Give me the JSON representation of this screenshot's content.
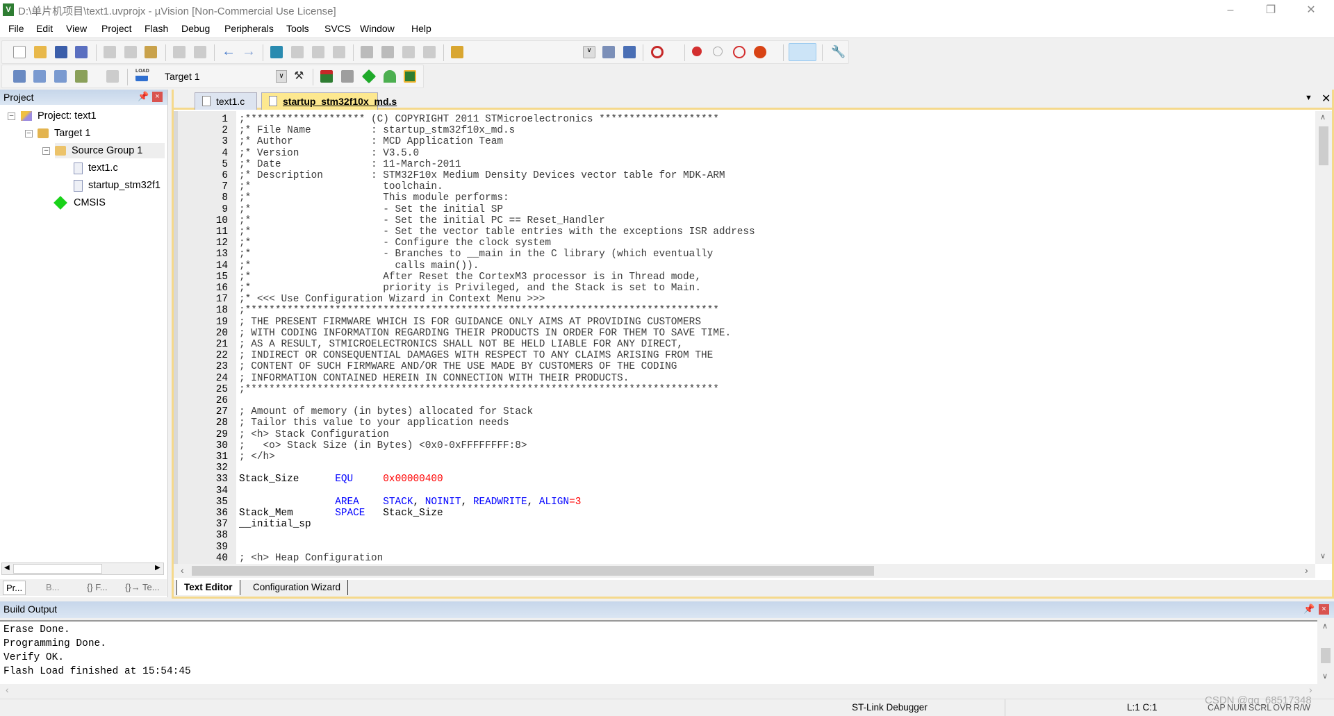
{
  "window": {
    "title": "D:\\单片机项目\\text1.uvprojx - µVision  [Non-Commercial Use License]",
    "app_icon": "V",
    "controls": [
      "minimize-icon",
      "restore-icon",
      "close-icon"
    ]
  },
  "menu": [
    "File",
    "Edit",
    "View",
    "Project",
    "Flash",
    "Debug",
    "Peripherals",
    "Tools",
    "SVCS",
    "Window",
    "Help"
  ],
  "toolbar": {
    "target": "Target 1",
    "icons1": [
      "new-file-icon",
      "open-icon",
      "save-icon",
      "save-all-icon",
      "cut-icon",
      "copy-icon",
      "paste-icon",
      "undo-icon",
      "redo-icon",
      "nav-back-icon",
      "nav-forward-icon",
      "bookmark-icon",
      "prev-bookmark-icon",
      "next-bookmark-icon",
      "clear-bookmarks-icon",
      "indent-icon",
      "unindent-icon",
      "comment-icon",
      "uncomment-icon",
      "find-in-files-icon",
      "dropdown-icon",
      "find-icon",
      "incremental-find-icon",
      "debug-session-icon",
      "breakpoint-icon",
      "disable-breakpoint-icon",
      "kill-breakpoints-icon",
      "debug-settings-icon",
      "window-layout-icon",
      "configure-icon"
    ],
    "icons2": [
      "translate-icon",
      "build-icon",
      "rebuild-icon",
      "batch-build-icon",
      "stop-build-icon",
      "download-icon",
      "target-options-icon",
      "file-extensions-icon",
      "manage-components-icon",
      "pack-installer-icon",
      "select-packs-icon",
      "run-env-icon"
    ],
    "load_label": "LOAD"
  },
  "project": {
    "title": "Project",
    "tree": [
      {
        "label": "Project: text1",
        "level": 0,
        "icon": "project-icon",
        "expanded": true
      },
      {
        "label": "Target 1",
        "level": 1,
        "icon": "target-folder-icon",
        "expanded": true
      },
      {
        "label": "Source Group 1",
        "level": 2,
        "icon": "folder-icon",
        "expanded": true,
        "selected": true
      },
      {
        "label": "text1.c",
        "level": 3,
        "icon": "file-icon"
      },
      {
        "label": "startup_stm32f1",
        "level": 3,
        "icon": "file-icon"
      },
      {
        "label": "CMSIS",
        "level": 2,
        "icon": "cmsis-icon"
      }
    ],
    "tabs": [
      "Pr...",
      "B...",
      "{} F...",
      "{}→ Te..."
    ]
  },
  "editor": {
    "tabs": [
      {
        "label": "text1.c",
        "active": false
      },
      {
        "label": "startup_stm32f10x_md.s",
        "active": true
      }
    ],
    "bottom_tabs": [
      "Text Editor",
      "Configuration Wizard"
    ],
    "lines": [
      [
        {
          "t": ";******************** (C) COPYRIGHT 2011 STMicroelectronics ********************",
          "c": "cm"
        }
      ],
      [
        {
          "t": ";* File Name          : startup_stm32f10x_md.s",
          "c": "cm"
        }
      ],
      [
        {
          "t": ";* Author             : MCD Application Team",
          "c": "cm"
        }
      ],
      [
        {
          "t": ";* Version            : V3.5.0",
          "c": "cm"
        }
      ],
      [
        {
          "t": ";* Date               : 11-March-2011",
          "c": "cm"
        }
      ],
      [
        {
          "t": ";* Description        : STM32F10x Medium Density Devices vector table for MDK-ARM",
          "c": "cm"
        }
      ],
      [
        {
          "t": ";*                      toolchain.",
          "c": "cm"
        }
      ],
      [
        {
          "t": ";*                      This module performs:",
          "c": "cm"
        }
      ],
      [
        {
          "t": ";*                      - Set the initial SP",
          "c": "cm"
        }
      ],
      [
        {
          "t": ";*                      - Set the initial PC == Reset_Handler",
          "c": "cm"
        }
      ],
      [
        {
          "t": ";*                      - Set the vector table entries with the exceptions ISR address",
          "c": "cm"
        }
      ],
      [
        {
          "t": ";*                      - Configure the clock system",
          "c": "cm"
        }
      ],
      [
        {
          "t": ";*                      - Branches to __main in the C library (which eventually",
          "c": "cm"
        }
      ],
      [
        {
          "t": ";*                        calls main()).",
          "c": "cm"
        }
      ],
      [
        {
          "t": ";*                      After Reset the CortexM3 processor is in Thread mode,",
          "c": "cm"
        }
      ],
      [
        {
          "t": ";*                      priority is Privileged, and the Stack is set to Main.",
          "c": "cm"
        }
      ],
      [
        {
          "t": ";* <<< Use Configuration Wizard in Context Menu >>>",
          "c": "cm"
        }
      ],
      [
        {
          "t": ";*******************************************************************************",
          "c": "cm"
        }
      ],
      [
        {
          "t": "; THE PRESENT FIRMWARE WHICH IS FOR GUIDANCE ONLY AIMS AT PROVIDING CUSTOMERS",
          "c": "cm"
        }
      ],
      [
        {
          "t": "; WITH CODING INFORMATION REGARDING THEIR PRODUCTS IN ORDER FOR THEM TO SAVE TIME.",
          "c": "cm"
        }
      ],
      [
        {
          "t": "; AS A RESULT, STMICROELECTRONICS SHALL NOT BE HELD LIABLE FOR ANY DIRECT,",
          "c": "cm"
        }
      ],
      [
        {
          "t": "; INDIRECT OR CONSEQUENTIAL DAMAGES WITH RESPECT TO ANY CLAIMS ARISING FROM THE",
          "c": "cm"
        }
      ],
      [
        {
          "t": "; CONTENT OF SUCH FIRMWARE AND/OR THE USE MADE BY CUSTOMERS OF THE CODING",
          "c": "cm"
        }
      ],
      [
        {
          "t": "; INFORMATION CONTAINED HEREIN IN CONNECTION WITH THEIR PRODUCTS.",
          "c": "cm"
        }
      ],
      [
        {
          "t": ";*******************************************************************************",
          "c": "cm"
        }
      ],
      [],
      [
        {
          "t": "; Amount of memory (in bytes) allocated for Stack",
          "c": "cm"
        }
      ],
      [
        {
          "t": "; Tailor this value to your application needs",
          "c": "cm"
        }
      ],
      [
        {
          "t": "; <h> Stack Configuration",
          "c": "cm"
        }
      ],
      [
        {
          "t": ";   <o> Stack Size (in Bytes) <0x0-0xFFFFFFFF:8>",
          "c": "cm"
        }
      ],
      [
        {
          "t": "; </h>",
          "c": "cm"
        }
      ],
      [],
      [
        {
          "t": "Stack_Size      ",
          "c": "pl"
        },
        {
          "t": "EQU",
          "c": "kw"
        },
        {
          "t": "     ",
          "c": "pl"
        },
        {
          "t": "0x00000400",
          "c": "num"
        }
      ],
      [],
      [
        {
          "t": "                ",
          "c": "pl"
        },
        {
          "t": "AREA",
          "c": "kw"
        },
        {
          "t": "    ",
          "c": "pl"
        },
        {
          "t": "STACK",
          "c": "kw"
        },
        {
          "t": ", ",
          "c": "pl"
        },
        {
          "t": "NOINIT",
          "c": "kw"
        },
        {
          "t": ", ",
          "c": "pl"
        },
        {
          "t": "READWRITE",
          "c": "kw"
        },
        {
          "t": ", ",
          "c": "pl"
        },
        {
          "t": "ALIGN",
          "c": "kw"
        },
        {
          "t": "=3",
          "c": "num"
        }
      ],
      [
        {
          "t": "Stack_Mem       ",
          "c": "pl"
        },
        {
          "t": "SPACE",
          "c": "kw"
        },
        {
          "t": "   Stack_Size",
          "c": "pl"
        }
      ],
      [
        {
          "t": "__initial_sp",
          "c": "pl"
        }
      ],
      [],
      [],
      [
        {
          "t": "; <h> Heap Configuration",
          "c": "cm"
        }
      ]
    ]
  },
  "build_output": {
    "title": "Build Output",
    "lines": [
      "Erase Done.",
      "Programming Done.",
      "Verify OK.",
      "Flash Load finished at 15:54:45"
    ]
  },
  "status": {
    "debugger": "ST-Link Debugger",
    "position": "L:1 C:1",
    "indicators": "CAP NUM SCRL OVR R/W",
    "watermark": "CSDN @qq_68517348"
  },
  "colors": {
    "keyword": "#0000ff",
    "number": "#ff0000",
    "active_tab": "#fde88f",
    "panel_header": "#cfdded"
  }
}
